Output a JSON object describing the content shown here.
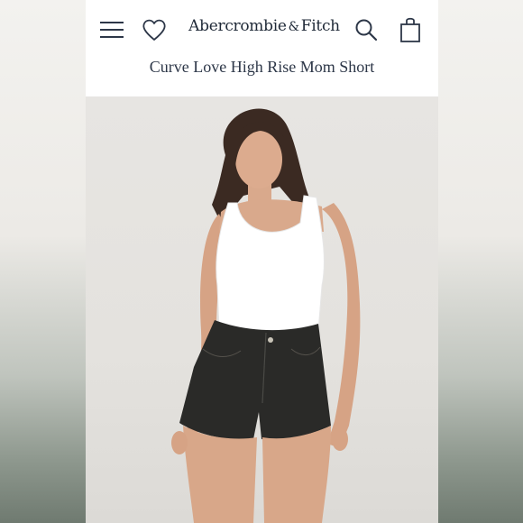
{
  "header": {
    "brand_main": "Abercrombie",
    "brand_amp": "&",
    "brand_end": "Fitch",
    "menu_icon": "hamburger-menu-icon",
    "wishlist_icon": "heart-icon",
    "search_icon": "search-icon",
    "bag_icon": "shopping-bag-icon"
  },
  "product": {
    "title": "Curve Love High Rise Mom Short"
  },
  "colors": {
    "brand_text": "#1f2937",
    "tank": "#ffffff",
    "shorts": "#2a2a28"
  }
}
